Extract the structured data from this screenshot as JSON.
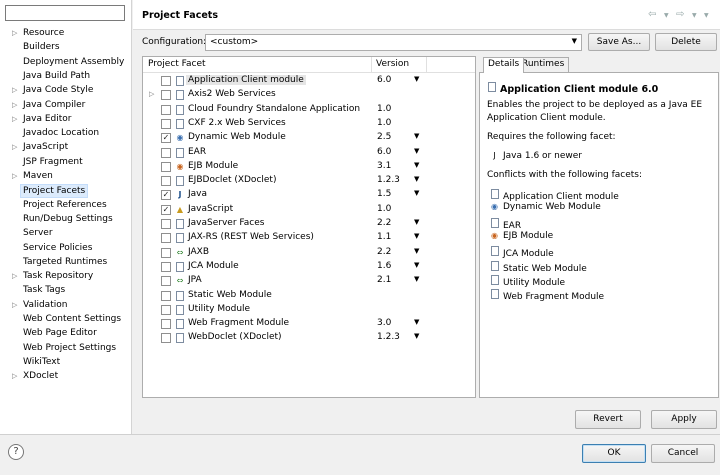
{
  "left": {
    "filter_value": "",
    "items": [
      {
        "label": "Resource",
        "expandable": true
      },
      {
        "label": "Builders",
        "expandable": false
      },
      {
        "label": "Deployment Assembly",
        "expandable": false
      },
      {
        "label": "Java Build Path",
        "expandable": false
      },
      {
        "label": "Java Code Style",
        "expandable": true
      },
      {
        "label": "Java Compiler",
        "expandable": true
      },
      {
        "label": "Java Editor",
        "expandable": true
      },
      {
        "label": "Javadoc Location",
        "expandable": false
      },
      {
        "label": "JavaScript",
        "expandable": true
      },
      {
        "label": "JSP Fragment",
        "expandable": false
      },
      {
        "label": "Maven",
        "expandable": true
      },
      {
        "label": "Project Facets",
        "expandable": false,
        "selected": true
      },
      {
        "label": "Project References",
        "expandable": false
      },
      {
        "label": "Run/Debug Settings",
        "expandable": false
      },
      {
        "label": "Server",
        "expandable": false
      },
      {
        "label": "Service Policies",
        "expandable": false
      },
      {
        "label": "Targeted Runtimes",
        "expandable": false
      },
      {
        "label": "Task Repository",
        "expandable": true
      },
      {
        "label": "Task Tags",
        "expandable": false
      },
      {
        "label": "Validation",
        "expandable": true
      },
      {
        "label": "Web Content Settings",
        "expandable": false
      },
      {
        "label": "Web Page Editor",
        "expandable": false
      },
      {
        "label": "Web Project Settings",
        "expandable": false
      },
      {
        "label": "WikiText",
        "expandable": false
      },
      {
        "label": "XDoclet",
        "expandable": true
      }
    ]
  },
  "header": {
    "title": "Project Facets",
    "back_icon": "back-arrow-icon",
    "forward_icon": "forward-arrow-icon"
  },
  "config": {
    "label": "Configuration:",
    "value": "<custom>",
    "save_as": "Save As...",
    "delete": "Delete"
  },
  "table": {
    "col_facet": "Project Facet",
    "col_version": "Version",
    "rows": [
      {
        "name": "Application Client module",
        "version": "6.0",
        "checked": false,
        "dropdown": true,
        "highlight": true,
        "icon": "doc"
      },
      {
        "name": "Axis2 Web Services",
        "version": "",
        "checked": false,
        "dropdown": false,
        "expandable": true,
        "icon": "doc"
      },
      {
        "name": "Cloud Foundry Standalone Application",
        "version": "1.0",
        "checked": false,
        "dropdown": false,
        "icon": "doc"
      },
      {
        "name": "CXF 2.x Web Services",
        "version": "1.0",
        "checked": false,
        "dropdown": false,
        "icon": "doc"
      },
      {
        "name": "Dynamic Web Module",
        "version": "2.5",
        "checked": true,
        "dropdown": true,
        "icon": "web"
      },
      {
        "name": "EAR",
        "version": "6.0",
        "checked": false,
        "dropdown": true,
        "icon": "doc"
      },
      {
        "name": "EJB Module",
        "version": "3.1",
        "checked": false,
        "dropdown": true,
        "icon": "ejb"
      },
      {
        "name": "EJBDoclet (XDoclet)",
        "version": "1.2.3",
        "checked": false,
        "dropdown": true,
        "icon": "doc"
      },
      {
        "name": "Java",
        "version": "1.5",
        "checked": true,
        "dropdown": true,
        "icon": "java"
      },
      {
        "name": "JavaScript",
        "version": "1.0",
        "checked": true,
        "dropdown": false,
        "icon": "js"
      },
      {
        "name": "JavaServer Faces",
        "version": "2.2",
        "checked": false,
        "dropdown": true,
        "icon": "doc"
      },
      {
        "name": "JAX-RS (REST Web Services)",
        "version": "1.1",
        "checked": false,
        "dropdown": true,
        "icon": "doc"
      },
      {
        "name": "JAXB",
        "version": "2.2",
        "checked": false,
        "dropdown": true,
        "icon": "jaxb"
      },
      {
        "name": "JCA Module",
        "version": "1.6",
        "checked": false,
        "dropdown": true,
        "icon": "doc"
      },
      {
        "name": "JPA",
        "version": "2.1",
        "checked": false,
        "dropdown": true,
        "icon": "jaxb"
      },
      {
        "name": "Static Web Module",
        "version": "",
        "checked": false,
        "dropdown": false,
        "icon": "doc"
      },
      {
        "name": "Utility Module",
        "version": "",
        "checked": false,
        "dropdown": false,
        "icon": "doc"
      },
      {
        "name": "Web Fragment Module",
        "version": "3.0",
        "checked": false,
        "dropdown": true,
        "icon": "doc"
      },
      {
        "name": "WebDoclet (XDoclet)",
        "version": "1.2.3",
        "checked": false,
        "dropdown": true,
        "icon": "doc"
      }
    ]
  },
  "details": {
    "tab_details": "Details",
    "tab_runtimes": "Runtimes",
    "heading": "Application Client module 6.0",
    "desc_line1": "Enables the project to be deployed as a Java EE",
    "desc_line2": "Application Client module.",
    "requires_label": "Requires the following facet:",
    "requires_item": "Java 1.6 or newer",
    "conflicts_label": "Conflicts with the following facets:",
    "conflicts": [
      {
        "name": "Application Client module",
        "icon": "doc"
      },
      {
        "name": "Dynamic Web Module",
        "icon": "web"
      },
      {
        "name": "EAR",
        "icon": "doc"
      },
      {
        "name": "EJB Module",
        "icon": "ejb"
      },
      {
        "name": "JCA Module",
        "icon": "doc"
      },
      {
        "name": "Static Web Module",
        "icon": "doc"
      },
      {
        "name": "Utility Module",
        "icon": "doc"
      },
      {
        "name": "Web Fragment Module",
        "icon": "doc"
      }
    ]
  },
  "buttons": {
    "revert": "Revert",
    "apply": "Apply",
    "ok": "OK",
    "cancel": "Cancel",
    "help_glyph": "?"
  }
}
